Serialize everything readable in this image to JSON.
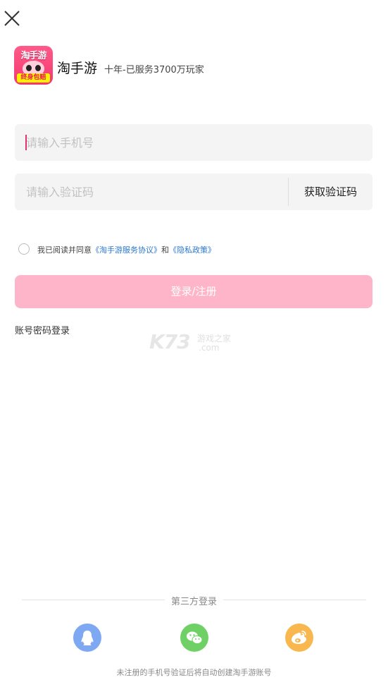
{
  "header": {
    "app_name": "淘手游",
    "slogan": "十年-已服务3700万玩家",
    "logo": {
      "top_text": "淘手游",
      "bottom_text": "终身包赔"
    }
  },
  "form": {
    "phone_placeholder": "请输入手机号",
    "code_placeholder": "请输入验证码",
    "get_code_label": "获取验证码"
  },
  "agreement": {
    "prefix": "我已阅读并同意",
    "service_link": "《淘手游服务协议》",
    "joiner": "和",
    "privacy_link": "《隐私政策》"
  },
  "login_button": "登录/注册",
  "password_login": "账号密码登录",
  "watermark": {
    "brand": "K73",
    "cn": "游戏之家",
    "domain": ".com"
  },
  "third_party": {
    "label": "第三方登录",
    "providers": [
      {
        "name": "qq-icon",
        "color": "#7ea8f2"
      },
      {
        "name": "wechat-icon",
        "color": "#6fd165"
      },
      {
        "name": "weibo-icon",
        "color": "#f9b84f"
      }
    ]
  },
  "footer_note": "未注册的手机号验证后将自动创建淘手游账号",
  "colors": {
    "accent": "#ffb5c9",
    "link": "#2a78d0",
    "caret": "#e4336b"
  }
}
